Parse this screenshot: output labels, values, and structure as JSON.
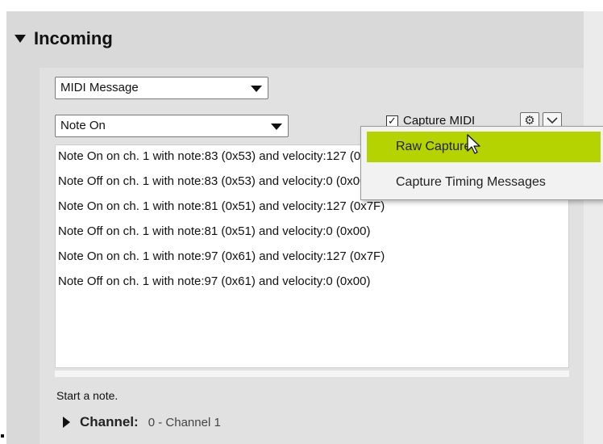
{
  "section": {
    "title": "Incoming"
  },
  "controls": {
    "message_type": "MIDI Message",
    "note_filter": "Note On",
    "capture_label": "Capture MIDI",
    "capture_checked": true
  },
  "log": [
    "Note On on ch. 1 with note:83 (0x53) and velocity:127 (0x7F)",
    "Note Off on ch. 1 with note:83 (0x53) and velocity:0 (0x00)",
    "Note On on ch. 1 with note:81 (0x51) and velocity:127 (0x7F)",
    "Note Off on ch. 1 with note:81 (0x51) and velocity:0 (0x00)",
    "Note On on ch. 1 with note:97 (0x61) and velocity:127 (0x7F)",
    "Note Off on ch. 1 with note:97 (0x61) and velocity:0 (0x00)"
  ],
  "hint": "Start a note.",
  "channel": {
    "label": "Channel:",
    "value": "0 - Channel 1"
  },
  "menu": {
    "items": [
      "Raw Capture",
      "Capture Timing Messages"
    ],
    "highlight_color": "#b4d300"
  }
}
